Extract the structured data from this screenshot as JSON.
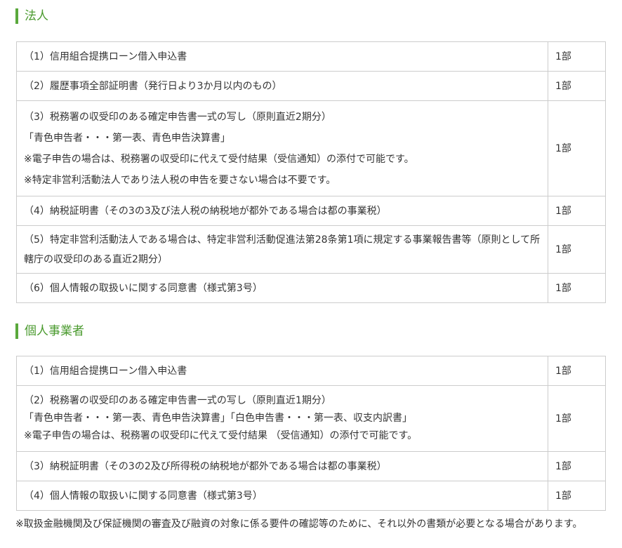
{
  "sections": [
    {
      "title": "法人",
      "rows": [
        {
          "lines": [
            "（1）信用組合提携ローン借入申込書"
          ],
          "qty": "1部"
        },
        {
          "lines": [
            "（2）履歴事項全部証明書（発行日より3か月以内のもの）"
          ],
          "qty": "1部"
        },
        {
          "lines": [
            "（3）税務署の収受印のある確定申告書一式の写し（原則直近2期分）",
            "「青色申告者・・・第一表、青色申告決算書」",
            "※電子申告の場合は、税務署の収受印に代えて受付結果（受信通知）の添付で可能です。",
            "※特定非営利活動法人であり法人税の申告を要さない場合は不要です。"
          ],
          "qty": "1部"
        },
        {
          "lines": [
            "（4）納税証明書（その3の3及び法人税の納税地が都外である場合は都の事業税）"
          ],
          "qty": "1部"
        },
        {
          "lines": [
            "（5）特定非営利活動法人である場合は、特定非営利活動促進法第28条第1項に規定する事業報告書等（原則として所轄庁の収受印のある直近2期分）"
          ],
          "qty": "1部"
        },
        {
          "lines": [
            "（6）個人情報の取扱いに関する同意書（様式第3号）"
          ],
          "qty": "1部"
        }
      ]
    },
    {
      "title": "個人事業者",
      "rows": [
        {
          "lines": [
            "（1）信用組合提携ローン借入申込書"
          ],
          "qty": "1部"
        },
        {
          "lines": [
            "（2）税務署の収受印のある確定申告書一式の写し（原則直近1期分）",
            "「青色申告者・・・第一表、青色申告決算書」「白色申告書・・・第一表、収支内訳書」",
            "※電子申告の場合は、税務署の収受印に代えて受付結果 （受信通知）の添付で可能です。"
          ],
          "qty": "1部"
        },
        {
          "lines": [
            "（3）納税証明書（その3の2及び所得税の納税地が都外である場合は都の事業税）"
          ],
          "qty": "1部"
        },
        {
          "lines": [
            "（4）個人情報の取扱いに関する同意書（様式第3号）"
          ],
          "qty": "1部"
        }
      ]
    }
  ],
  "note": "※取扱金融機関及び保証機関の審査及び融資の対象に係る要件の確認等のために、それ以外の書類が必要となる場合があります。",
  "colors": {
    "accent": "#5aa83c",
    "heading_text": "#4a9a2e",
    "border": "#cccccc",
    "text": "#333333"
  }
}
